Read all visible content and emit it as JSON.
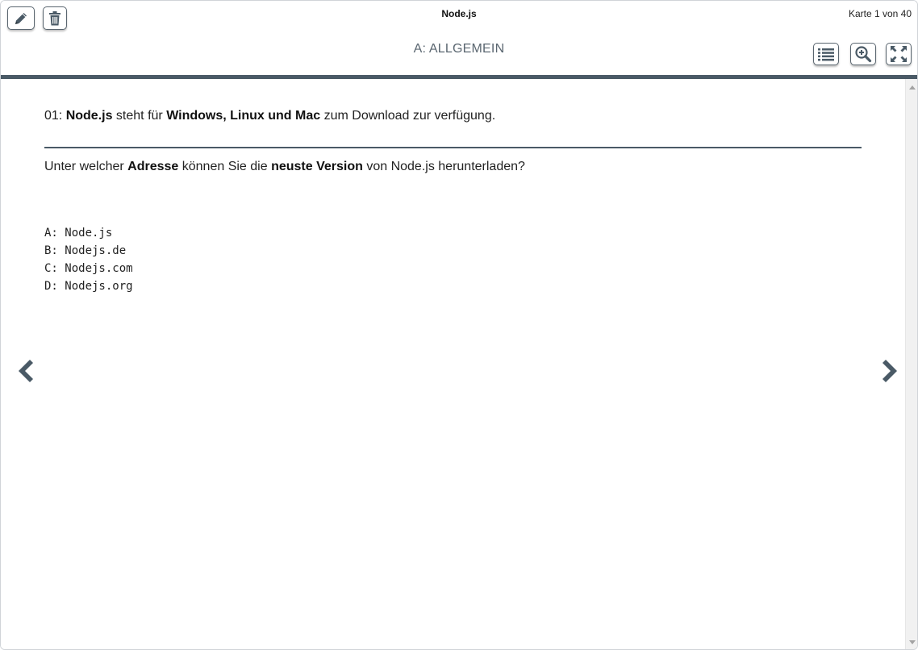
{
  "header": {
    "app_title": "Node.js",
    "card_counter": "Karte 1 von 40",
    "category": "A: ALLGEMEIN"
  },
  "toolbar_left": {
    "edit_icon": "pencil-icon",
    "delete_icon": "trash-icon"
  },
  "toolbar_right": {
    "list_icon": "list-icon",
    "zoom_icon": "zoom-in-icon",
    "fullscreen_icon": "fullscreen-icon"
  },
  "card": {
    "statement": {
      "prefix": "01: ",
      "term": "Node.js",
      "mid": " steht für ",
      "platforms": "Windows, Linux und Mac",
      "suffix": " zum Download zur verfügung."
    },
    "question": {
      "part1": "Unter welcher ",
      "bold1": "Adresse",
      "part2": " können Sie die ",
      "bold2": "neuste Version",
      "part3": " von Node.js herunterladen?"
    },
    "answers": [
      "A: Node.js",
      "B: Nodejs.de",
      "C: Nodejs.com",
      "D: Nodejs.org"
    ]
  },
  "navigation": {
    "prev_icon": "chevron-left-icon",
    "next_icon": "chevron-right-icon"
  },
  "colors": {
    "accent": "#4a5a66",
    "category_text": "#5a6670"
  }
}
